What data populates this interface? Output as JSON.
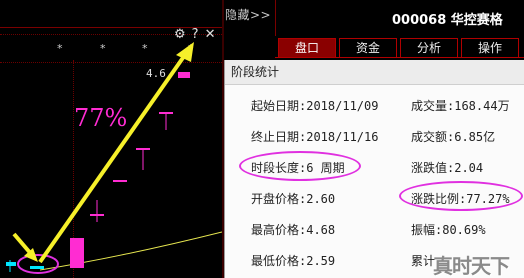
{
  "toolbar": {
    "hide_label": "隐藏>>"
  },
  "stock": {
    "code": "000068",
    "name": "华控赛格",
    "title": "000068 华控赛格"
  },
  "tabs": [
    {
      "label": "盘口",
      "active": true
    },
    {
      "label": "资金",
      "active": false
    },
    {
      "label": "分析",
      "active": false
    },
    {
      "label": "操作",
      "active": false
    }
  ],
  "chart": {
    "stars": [
      "*",
      "*",
      "*",
      "*"
    ],
    "icons": {
      "gear": "⚙",
      "help": "?",
      "close": "✕"
    },
    "pct_label": "77%",
    "price_label": "4.6",
    "colors": {
      "up": "#ff2cd2",
      "down": "#00e6ff",
      "arrow": "#f6f02a",
      "ma": "#f0f050"
    }
  },
  "dialog": {
    "title": "阶段统计",
    "left": [
      {
        "label": "起始日期:",
        "value": "2018/11/09"
      },
      {
        "label": "终止日期:",
        "value": "2018/11/16"
      },
      {
        "label": "时段长度:",
        "value": "6 周期"
      },
      {
        "label": "开盘价格:",
        "value": "2.60"
      },
      {
        "label": "最高价格:",
        "value": "4.68"
      },
      {
        "label": "最低价格:",
        "value": "2.59"
      }
    ],
    "right": [
      {
        "label": "成交量:",
        "value": "168.44万"
      },
      {
        "label": "成交额:",
        "value": "6.85亿"
      },
      {
        "label": "涨跌值:",
        "value": "2.04"
      },
      {
        "label": "涨跌比例:",
        "value": "77.27%"
      },
      {
        "label": "振幅:",
        "value": "80.69%"
      },
      {
        "label": "累计",
        "value": ""
      }
    ]
  },
  "watermark": "真时天下"
}
